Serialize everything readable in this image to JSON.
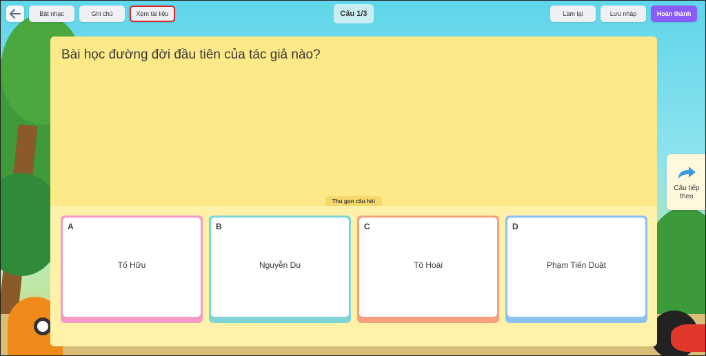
{
  "toolbar": {
    "music_label": "Bật nhạc",
    "notes_label": "Ghi chú",
    "docs_label": "Xem tài liệu",
    "retry_label": "Làm lại",
    "draft_label": "Lưu nháp",
    "finish_label": "Hoàn thành",
    "finish_color": "#8b5cf6"
  },
  "counter": "Câu 1/3",
  "question": {
    "text": "Bài học đường đời đầu tiên của tác giả nào?",
    "collapse_label": "Thu gọn câu hỏi"
  },
  "answers": [
    {
      "letter": "A",
      "text": "Tố Hữu",
      "color": "#f49ac6"
    },
    {
      "letter": "B",
      "text": "Nguyễn Du",
      "color": "#7fd6d6"
    },
    {
      "letter": "C",
      "text": "Tô Hoài",
      "color": "#f7a07f"
    },
    {
      "letter": "D",
      "text": "Phạm Tiến Duật",
      "color": "#8cc2f0"
    }
  ],
  "next": {
    "label": "Câu tiếp theo",
    "icon": "forward-arrow-icon"
  }
}
